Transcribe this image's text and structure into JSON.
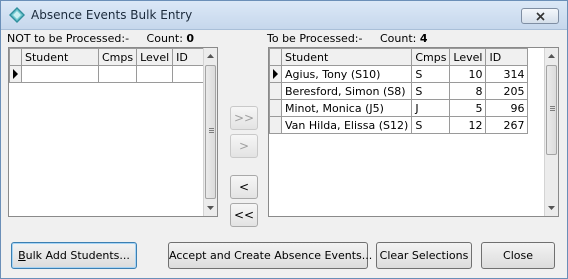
{
  "window": {
    "title": "Absence Events Bulk Entry",
    "icon": "diamond-app-icon"
  },
  "left_panel": {
    "heading": "NOT to be Processed:-",
    "count_label": "Count:",
    "count_value": "0",
    "columns": [
      "Student",
      "Cmps",
      "Level",
      "ID"
    ],
    "rows": []
  },
  "right_panel": {
    "heading": "To be Processed:-",
    "count_label": "Count:",
    "count_value": "4",
    "columns": [
      "Student",
      "Cmps",
      "Level",
      "ID"
    ],
    "rows": [
      {
        "student": "Agius, Tony (S10)",
        "cmps": "S",
        "level": "10",
        "id": "314"
      },
      {
        "student": "Beresford, Simon (S8)",
        "cmps": "S",
        "level": "8",
        "id": "205"
      },
      {
        "student": "Minot, Monica (J5)",
        "cmps": "J",
        "level": "5",
        "id": "96"
      },
      {
        "student": "Van Hilda, Elissa (S12)",
        "cmps": "S",
        "level": "12",
        "id": "267"
      }
    ]
  },
  "move_buttons": {
    "move_all_right": ">>",
    "move_right": ">",
    "move_left": "<",
    "move_all_left": "<<"
  },
  "footer": {
    "bulk_add_prefix": "B",
    "bulk_add_rest": "ulk Add Students...",
    "accept": "Accept and Create Absence Events...",
    "clear": "Clear Selections",
    "close": "Close"
  },
  "colors": {
    "titlebar": "#c6d7ec",
    "window_bg": "#f0f0f0",
    "default_button_border": "#3c7fb1"
  }
}
